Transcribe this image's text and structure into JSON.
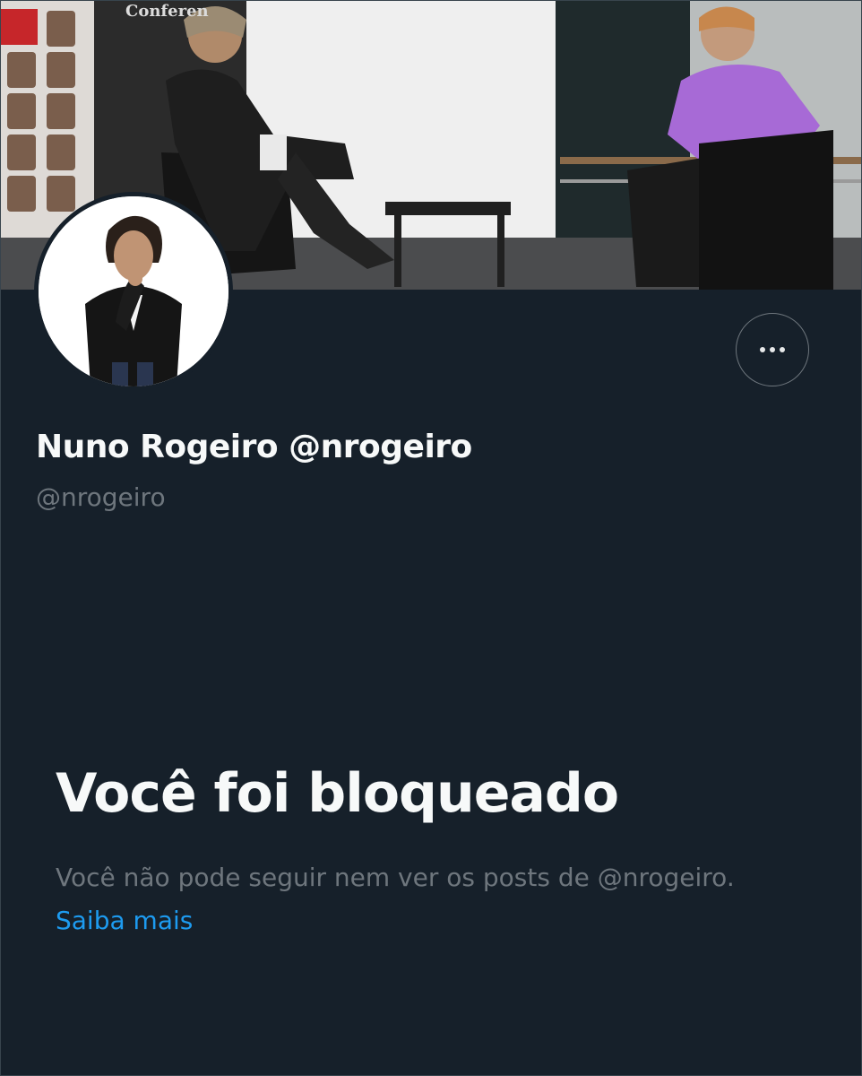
{
  "profile": {
    "display_name": "Nuno Rogeiro @nrogeiro",
    "handle": "@nrogeiro",
    "banner_image": "conference-stage-interview-photo",
    "avatar_image": "man-in-dark-suit-portrait",
    "more_icon": "more-horizontal-icon"
  },
  "blocked": {
    "title": "Você foi bloqueado",
    "description": "Você não pode seguir nem ver os posts de @nrogeiro.",
    "learn_more": "Saiba mais"
  },
  "colors": {
    "background": "#16202a",
    "text_primary": "#f7f9f9",
    "text_secondary": "#6e767d",
    "link": "#1d9bf0",
    "border": "#38444d"
  }
}
